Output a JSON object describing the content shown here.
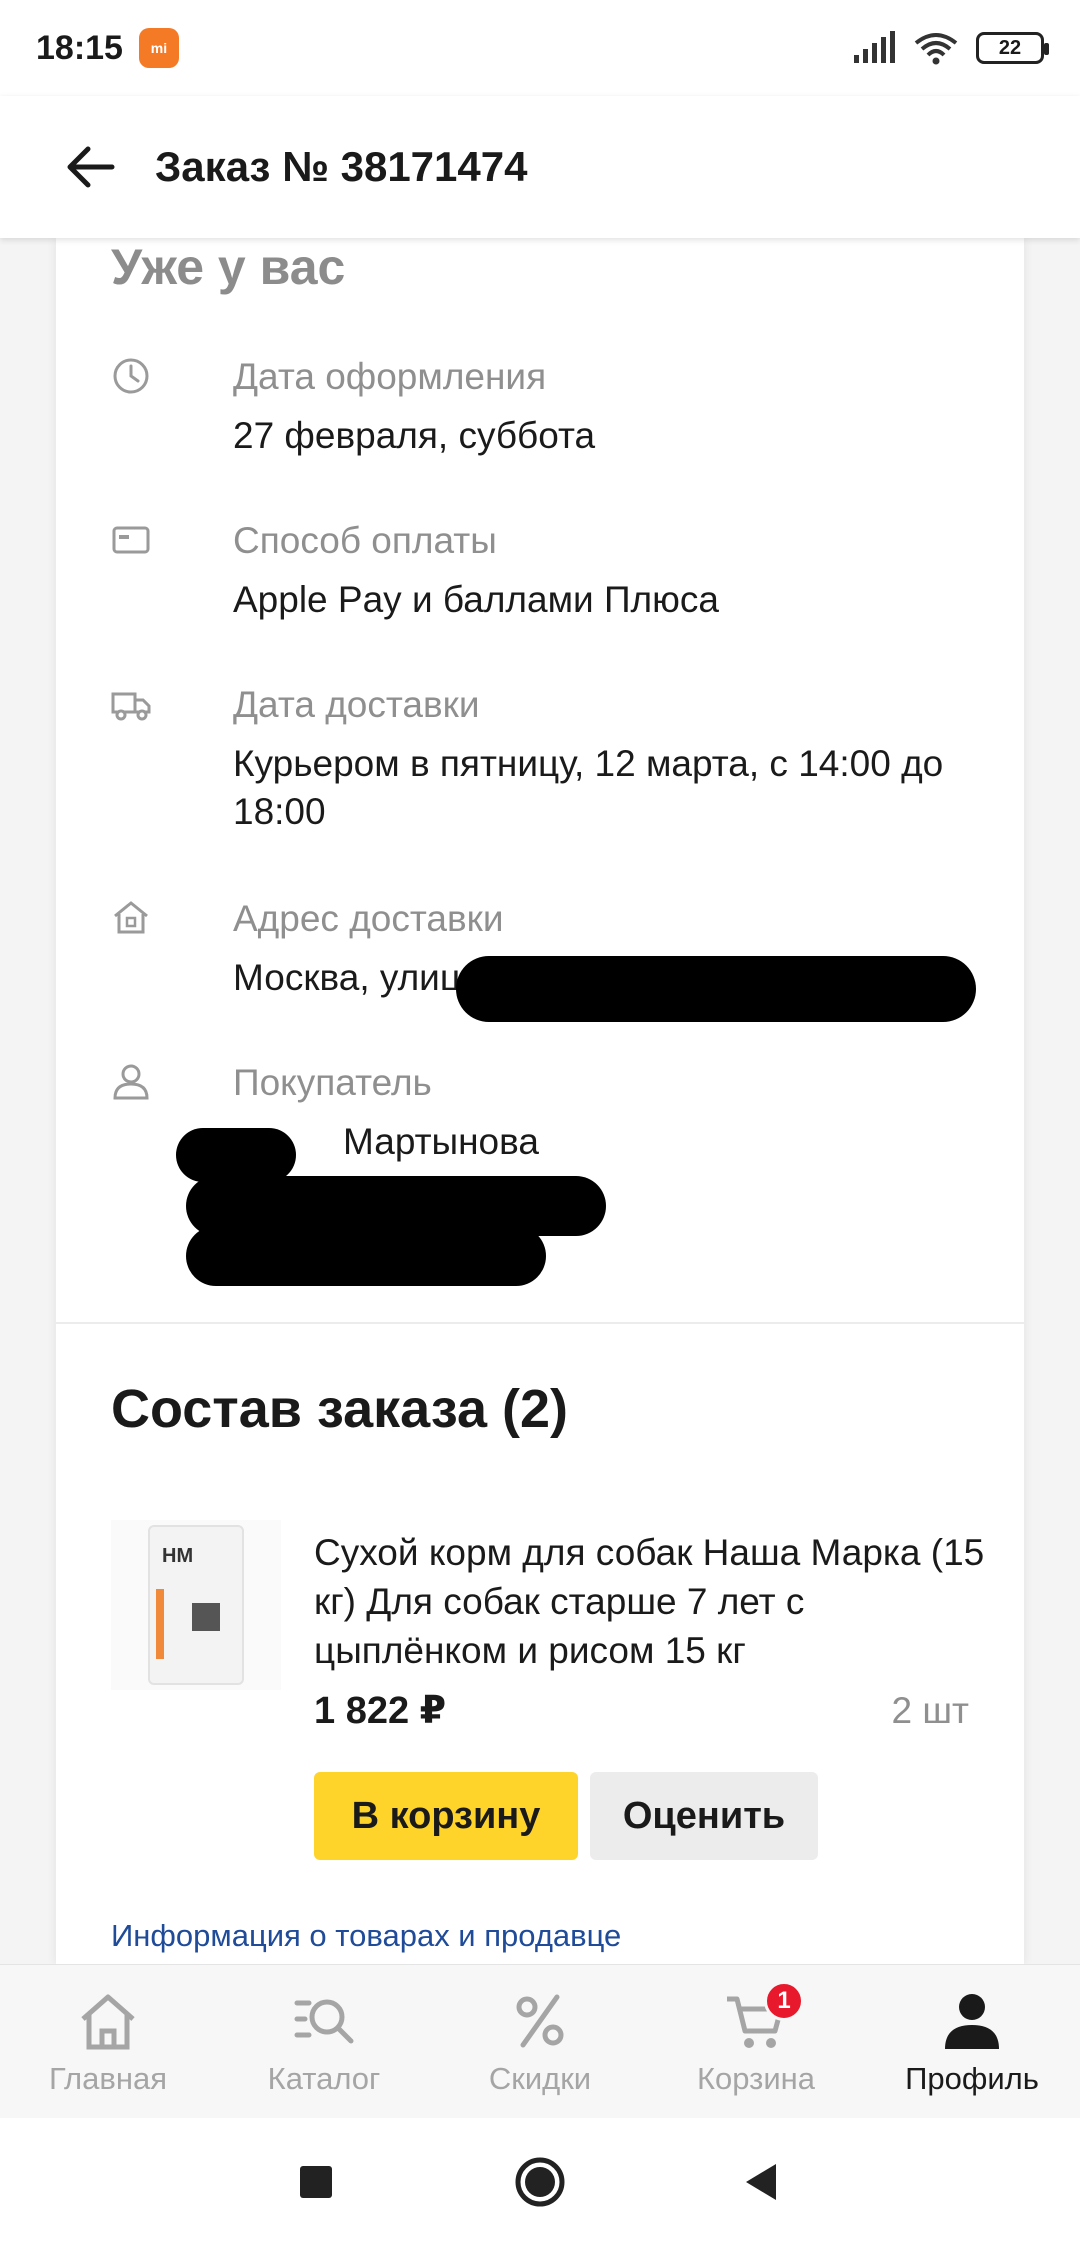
{
  "status_bar": {
    "time": "18:15",
    "battery": "22"
  },
  "header": {
    "title": "Заказ № 38171474"
  },
  "order_status": {
    "title": "Уже у вас"
  },
  "details": [
    {
      "icon": "clock-icon",
      "label": "Дата оформления",
      "value": "27 февраля, суббота"
    },
    {
      "icon": "card-icon",
      "label": "Способ оплаты",
      "value": "Apple Pay и баллами Плюса"
    },
    {
      "icon": "truck-icon",
      "label": "Дата доставки",
      "value": "Курьером в пятницу, 12 марта, с 14:00 до 18:00"
    },
    {
      "icon": "home-address-icon",
      "label": "Адрес доставки",
      "value": "Москва, улица П"
    },
    {
      "icon": "person-icon",
      "label": "Покупатель",
      "value": "Мартынова"
    }
  ],
  "order_items": {
    "title": "Состав заказа (2)",
    "product": {
      "name": "Сухой корм для собак Наша Марка (15 кг) Для собак старше 7 лет с цыплёнком и рисом 15 кг",
      "price": "1 822 ₽",
      "quantity": "2 шт",
      "brand_mark": "HM"
    },
    "add_to_cart_label": "В корзину",
    "rate_label": "Оценить",
    "info_link": "Информация о товарах и продавце"
  },
  "bottom_nav": [
    {
      "label": "Главная",
      "icon": "home-icon"
    },
    {
      "label": "Каталог",
      "icon": "catalog-search-icon"
    },
    {
      "label": "Скидки",
      "icon": "percent-icon"
    },
    {
      "label": "Корзина",
      "icon": "cart-icon",
      "badge": "1"
    },
    {
      "label": "Профиль",
      "icon": "profile-icon",
      "active": true
    }
  ],
  "colors": {
    "accent_yellow": "#fed42b",
    "link_blue": "#1f4b99",
    "badge_red": "#e8192c"
  }
}
